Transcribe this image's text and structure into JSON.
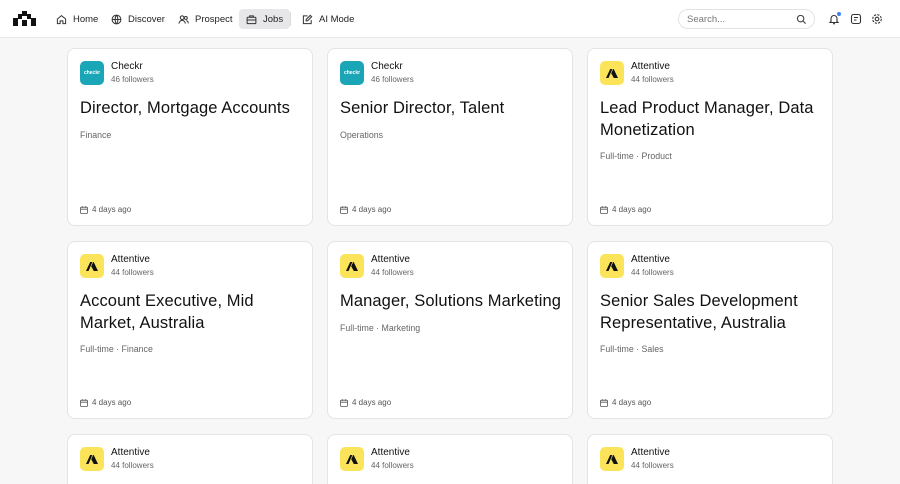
{
  "nav": {
    "items": [
      {
        "label": "Home",
        "icon": "home-icon"
      },
      {
        "label": "Discover",
        "icon": "globe-icon"
      },
      {
        "label": "Prospect",
        "icon": "users-icon"
      },
      {
        "label": "Jobs",
        "icon": "briefcase-icon",
        "active": true
      },
      {
        "label": "AI Mode",
        "icon": "ai-edit-icon"
      }
    ]
  },
  "search": {
    "placeholder": "Search..."
  },
  "header_icons": [
    "bell-icon",
    "messages-icon",
    "settings-icon"
  ],
  "accent_color": "#3b82f6",
  "jobs": [
    {
      "company": "Checkr",
      "logo_text": "checkr",
      "followers": "46 followers",
      "title": "Director, Mortgage Accounts",
      "meta": "Finance",
      "posted": "4 days ago"
    },
    {
      "company": "Checkr",
      "logo_text": "checkr",
      "followers": "46 followers",
      "title": "Senior Director, Talent",
      "meta": "Operations",
      "posted": "4 days ago"
    },
    {
      "company": "Attentive",
      "followers": "44 followers",
      "title": "Lead Product Manager, Data Monetization",
      "meta": "Full-time · Product",
      "posted": "4 days ago"
    },
    {
      "company": "Attentive",
      "followers": "44 followers",
      "title": "Account Executive, Mid Market, Australia",
      "meta": "Full-time · Finance",
      "posted": "4 days ago"
    },
    {
      "company": "Attentive",
      "followers": "44 followers",
      "title": "Manager, Solutions Marketing",
      "meta": "Full-time · Marketing",
      "posted": "4 days ago"
    },
    {
      "company": "Attentive",
      "followers": "44 followers",
      "title": "Senior Sales Development Representative, Australia",
      "meta": "Full-time · Sales",
      "posted": "4 days ago"
    },
    {
      "company": "Attentive",
      "followers": "44 followers"
    },
    {
      "company": "Attentive",
      "followers": "44 followers"
    },
    {
      "company": "Attentive",
      "followers": "44 followers"
    }
  ]
}
